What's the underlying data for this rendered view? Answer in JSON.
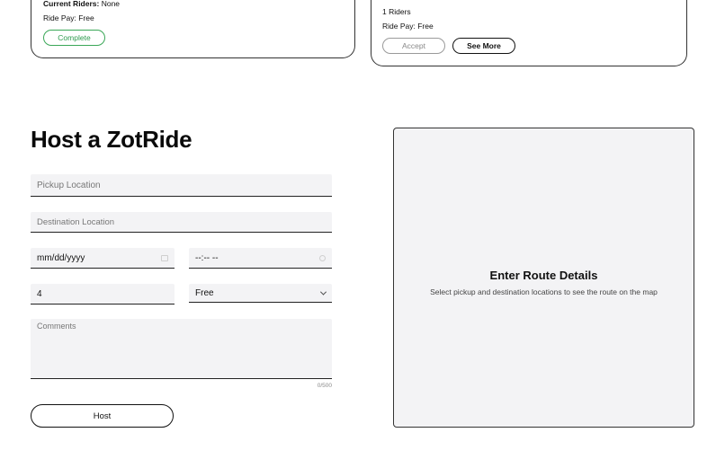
{
  "ride_cards": [
    {
      "riders_label": "Current Riders:",
      "riders_value": "None",
      "pay_text": "Ride Pay: Free",
      "action_label": "Complete"
    },
    {
      "riders_text": "1 Riders",
      "pay_text": "Ride Pay: Free",
      "accept_label": "Accept",
      "see_more_label": "See More"
    }
  ],
  "host_form": {
    "title": "Host a ZotRide",
    "pickup_placeholder": "Pickup Location",
    "destination_placeholder": "Destination Location",
    "date_value": "mm/dd/yyyy",
    "time_value": "--:-- --",
    "seats_value": "4",
    "pay_selected": "Free",
    "comments_placeholder": "Comments",
    "char_count": "0/500",
    "submit_label": "Host"
  },
  "map": {
    "title": "Enter Route Details",
    "subtitle": "Select pickup and destination locations to see the route on the map"
  },
  "colors": {
    "complete_green": "#2e9b4e",
    "field_bg": "#f3f3f5",
    "border_dark": "#222222"
  }
}
